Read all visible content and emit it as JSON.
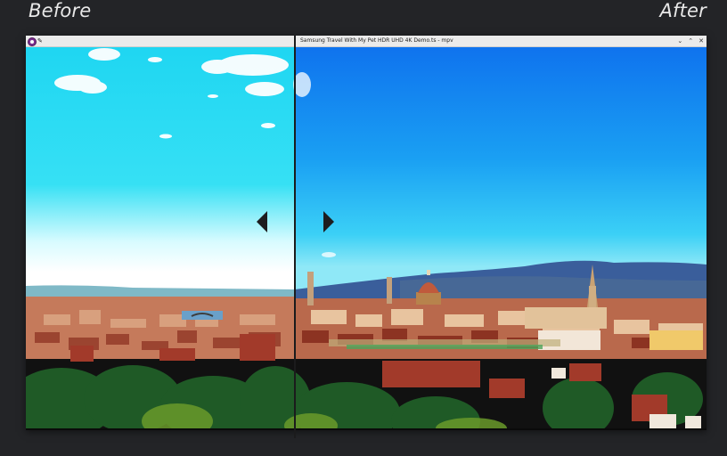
{
  "labels": {
    "before": "Before",
    "after": "After"
  },
  "window": {
    "title": "Samsung Travel With My Pet HDR UHD 4K Demo.ts - mpv",
    "controls": {
      "minimize": "⌄",
      "maximize": "⌃",
      "close": "✕"
    },
    "pin_glyph": "✎"
  },
  "colors": {
    "page_bg": "#232427",
    "sky_before": "#2ad9f0",
    "sky_after": "#138af0",
    "divider": "#1b1b1c"
  }
}
